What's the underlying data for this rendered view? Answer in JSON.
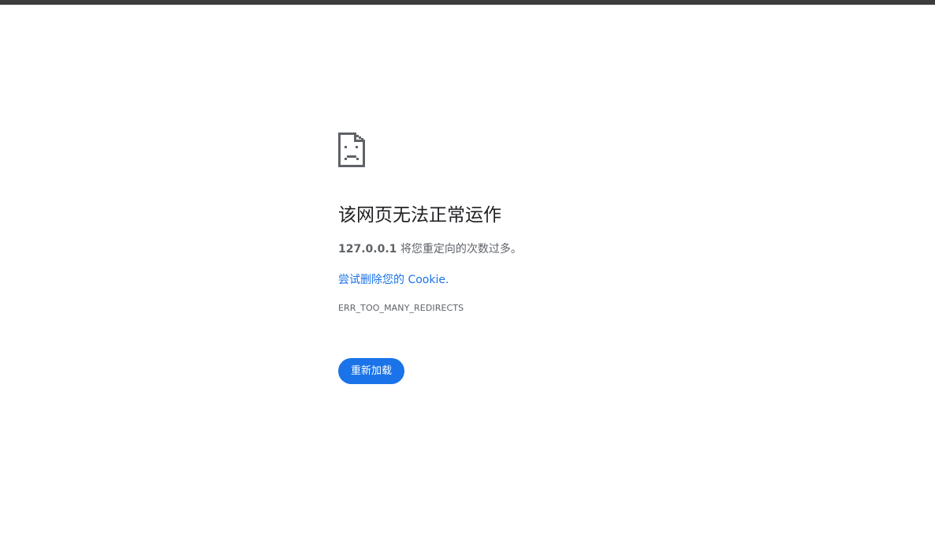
{
  "page": {
    "background_color": "#ffffff",
    "top_strip_color": "#3c3c3c"
  },
  "error": {
    "icon": "sad-page-icon",
    "title": "该网页无法正常运作",
    "host": "127.0.0.1",
    "message_suffix": " 将您重定向的次数过多。",
    "suggestion_link": "尝试删除您的 Cookie.",
    "code": "ERR_TOO_MANY_REDIRECTS",
    "reload_label": "重新加载"
  },
  "colors": {
    "accent": "#1a73e8",
    "title_text": "#202124",
    "body_text": "#5f6368"
  }
}
